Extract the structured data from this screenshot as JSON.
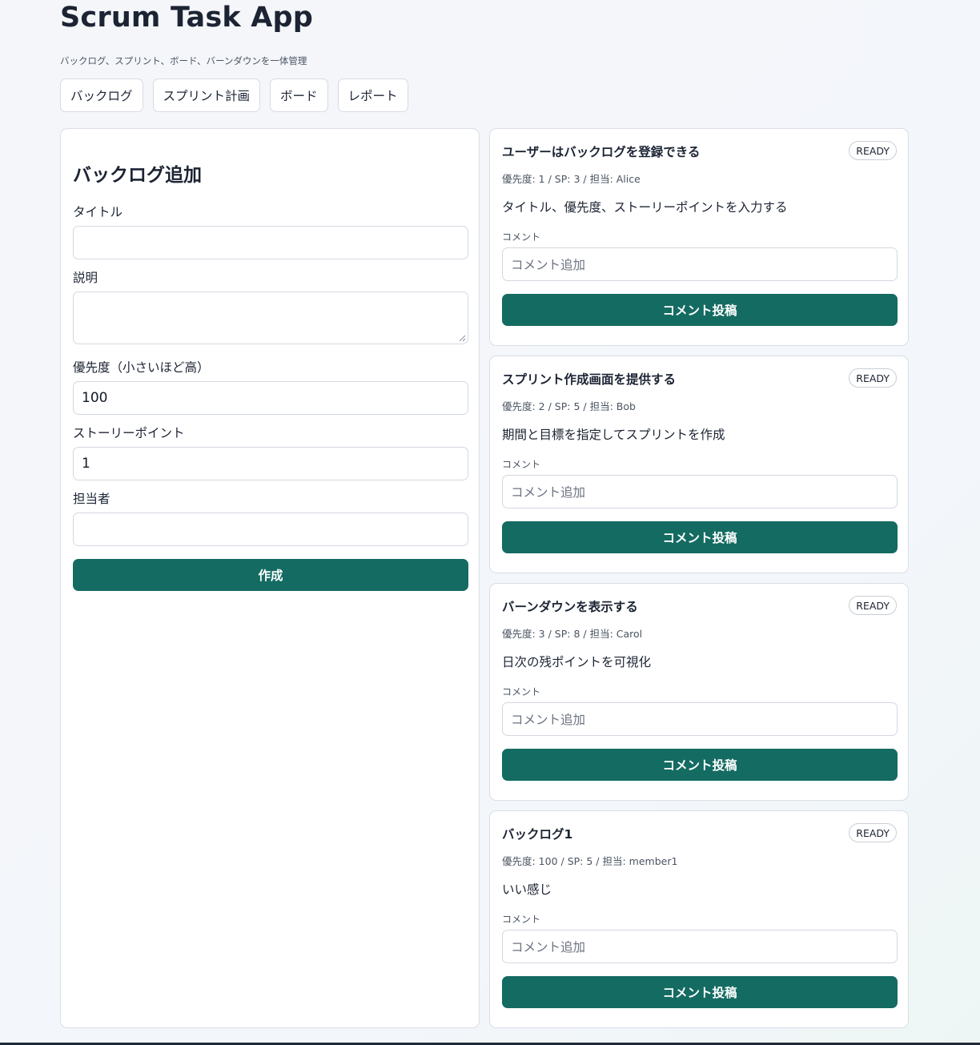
{
  "app": {
    "title": "Scrum Task App",
    "subtitle": "バックログ、スプリント、ボード、バーンダウンを一体管理"
  },
  "nav": {
    "tabs": [
      {
        "label": "バックログ"
      },
      {
        "label": "スプリント計画"
      },
      {
        "label": "ボード"
      },
      {
        "label": "レポート"
      }
    ]
  },
  "form": {
    "heading": "バックログ追加",
    "title_label": "タイトル",
    "title_value": "",
    "description_label": "説明",
    "description_value": "",
    "priority_label": "優先度（小さいほど高）",
    "priority_value": "100",
    "story_points_label": "ストーリーポイント",
    "story_points_value": "1",
    "assignee_label": "担当者",
    "assignee_value": "",
    "create_label": "作成"
  },
  "backlog": {
    "items": [
      {
        "title": "ユーザーはバックログを登録できる",
        "status": "READY",
        "meta": "優先度: 1 / SP: 3 / 担当: Alice",
        "description": "タイトル、優先度、ストーリーポイントを入力する",
        "comment_label": "コメント",
        "comment_placeholder": "コメント追加",
        "post_label": "コメント投稿"
      },
      {
        "title": "スプリント作成画面を提供する",
        "status": "READY",
        "meta": "優先度: 2 / SP: 5 / 担当: Bob",
        "description": "期間と目標を指定してスプリントを作成",
        "comment_label": "コメント",
        "comment_placeholder": "コメント追加",
        "post_label": "コメント投稿"
      },
      {
        "title": "バーンダウンを表示する",
        "status": "READY",
        "meta": "優先度: 3 / SP: 8 / 担当: Carol",
        "description": "日次の残ポイントを可視化",
        "comment_label": "コメント",
        "comment_placeholder": "コメント追加",
        "post_label": "コメント投稿"
      },
      {
        "title": "バックログ1",
        "status": "READY",
        "meta": "優先度: 100 / SP: 5 / 担当: member1",
        "description": "いい感じ",
        "comment_label": "コメント",
        "comment_placeholder": "コメント追加",
        "post_label": "コメント投稿"
      }
    ]
  },
  "colors": {
    "primary": "#146b62",
    "border": "#d9dee6",
    "text": "#1c2433"
  }
}
